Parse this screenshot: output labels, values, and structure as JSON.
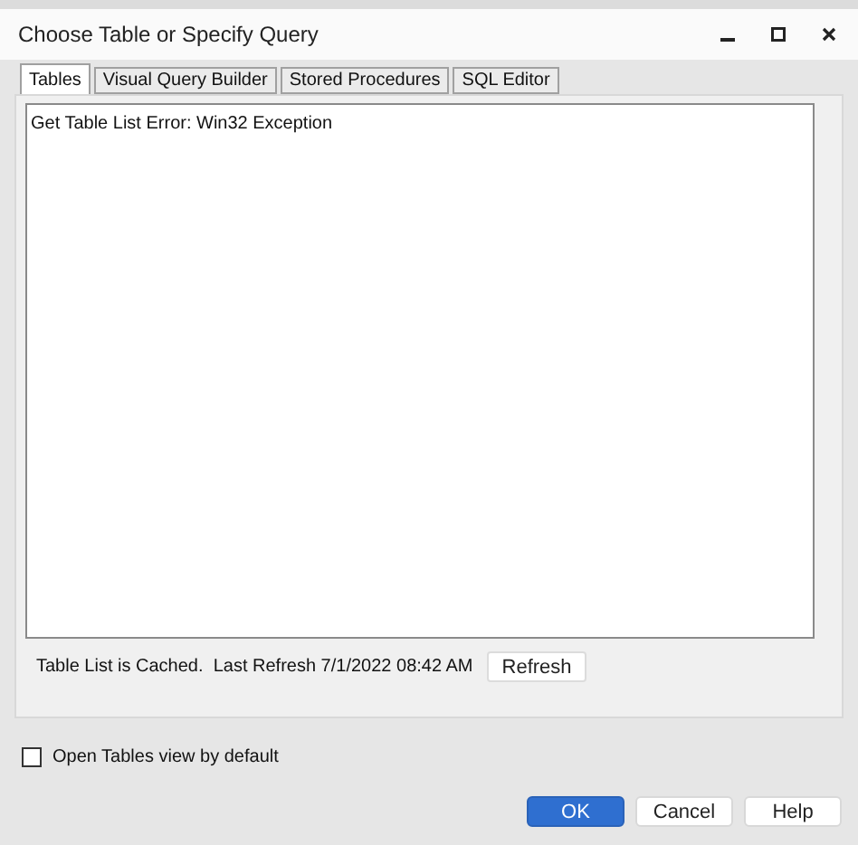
{
  "window": {
    "title": "Choose Table or Specify Query"
  },
  "tabs": [
    {
      "label": "Tables",
      "selected": true
    },
    {
      "label": "Visual Query Builder",
      "selected": false
    },
    {
      "label": "Stored Procedures",
      "selected": false
    },
    {
      "label": "SQL Editor",
      "selected": false
    }
  ],
  "table_list": {
    "message": "Get Table List Error: Win32 Exception"
  },
  "cache_status": "Table List is Cached.  Last Refresh 7/1/2022 08:42 AM",
  "refresh_button": "Refresh",
  "open_tables_default": {
    "label": "Open Tables view by default",
    "checked": false
  },
  "buttons": [
    {
      "label": "OK",
      "kind": "primary"
    },
    {
      "label": "Cancel",
      "kind": "normal"
    },
    {
      "label": "Help",
      "kind": "normal"
    }
  ]
}
